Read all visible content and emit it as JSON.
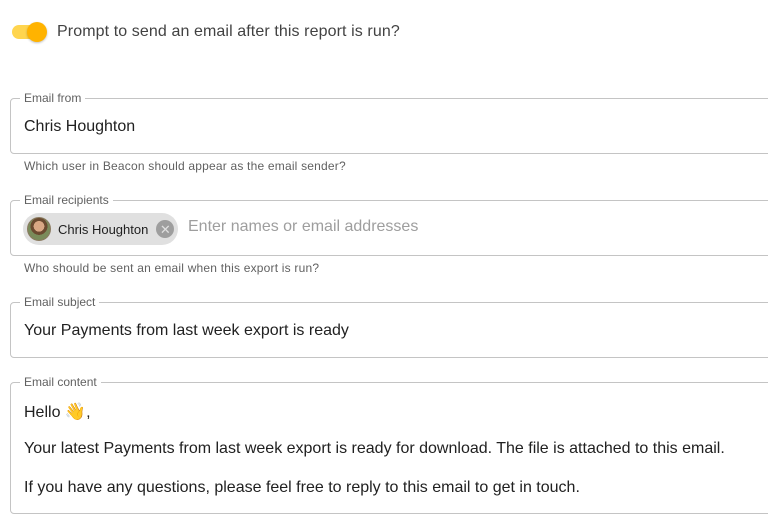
{
  "toggle": {
    "label": "Prompt to send an email after this report is run?",
    "enabled": true,
    "colors": {
      "track": "#ffd54f",
      "thumb": "#ffb300"
    }
  },
  "email_from": {
    "legend": "Email from",
    "value": "Chris Houghton",
    "helper": "Which user in Beacon should appear as the email sender?"
  },
  "email_recipients": {
    "legend": "Email recipients",
    "chips": [
      {
        "label": "Chris Houghton",
        "delete_icon": "cancel-icon"
      }
    ],
    "placeholder": "Enter names or email addresses",
    "helper": "Who should be sent an email when this export is run?"
  },
  "email_subject": {
    "legend": "Email subject",
    "value": "Your Payments from last week export is ready"
  },
  "email_content": {
    "legend": "Email content",
    "greeting": "Hello",
    "greeting_emoji": "👋",
    "greeting_suffix": ",",
    "lines": [
      "Your latest Payments from last week export is ready for download. The file is attached to this email.",
      "If you have any questions, please feel free to reply to this email to get in touch."
    ]
  }
}
